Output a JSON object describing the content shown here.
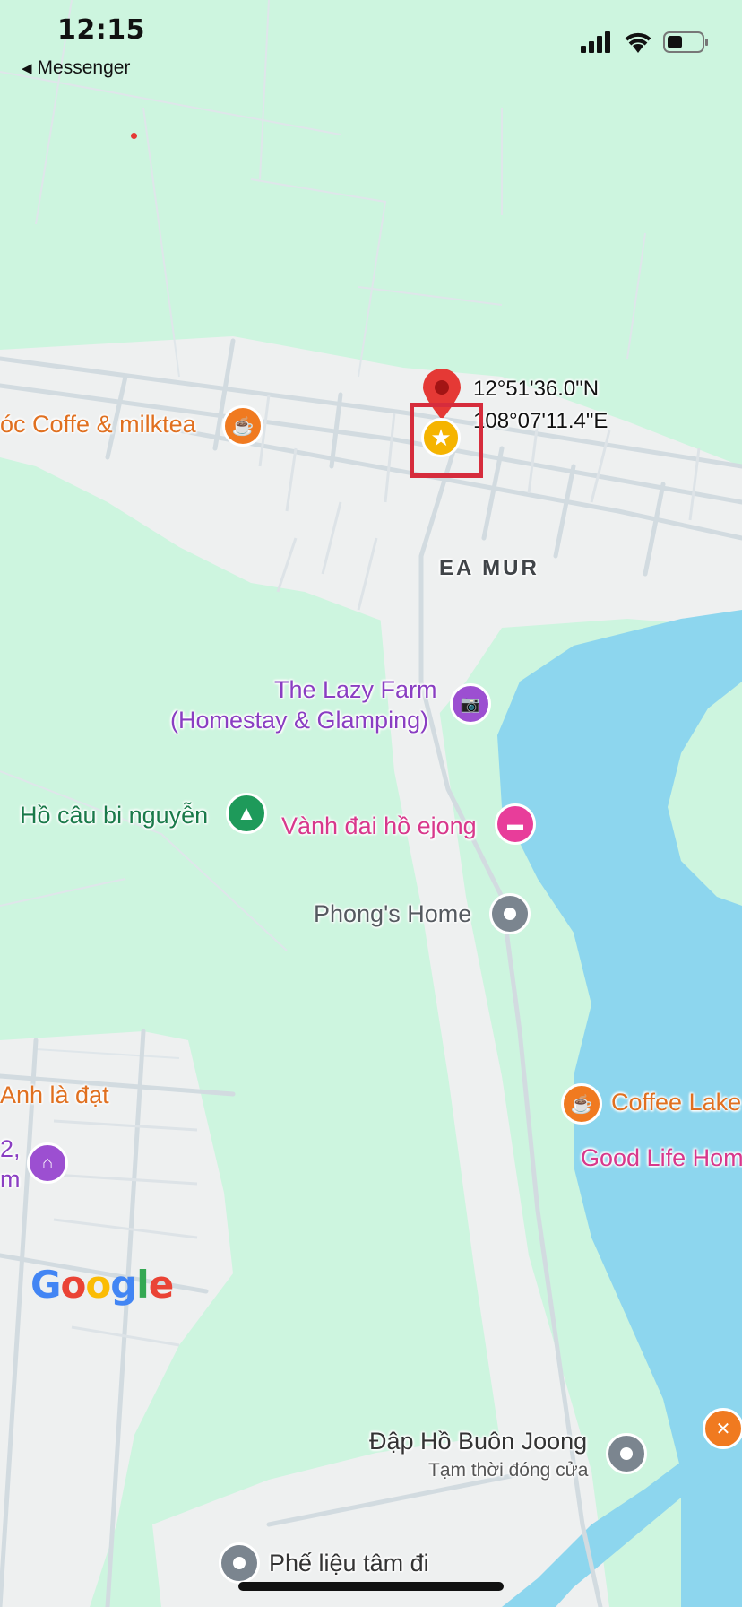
{
  "status_bar": {
    "time": "12:15",
    "back_app": "Messenger",
    "back_glyph": "◀",
    "icons": [
      "cellular-signal-icon",
      "wifi-icon",
      "battery-icon"
    ]
  },
  "map": {
    "pin": {
      "lat": "12°51'36.0\"N",
      "lng": "108°07'11.4\"E"
    },
    "area_label": "EA MUR",
    "places": [
      {
        "name": "óc Coffe & milktea",
        "icon": "coffee-icon",
        "color": "#f07a20"
      },
      {
        "name": "The Lazy Farm",
        "name_line2": "(Homestay & Glamping)",
        "icon": "camera-icon",
        "color": "#9c4fd1"
      },
      {
        "name": "Hồ câu bi nguyễn",
        "icon": "tree-icon",
        "color": "#1e9a5a"
      },
      {
        "name": "Vành đai hồ ejong",
        "icon": "bed-icon",
        "color": "#e83d9a"
      },
      {
        "name": "Phong's Home",
        "icon": "place-icon",
        "color": "#7b858f"
      },
      {
        "name": "Anh là đạt",
        "icon": "",
        "color": "#e07020"
      },
      {
        "name_line1": "2,",
        "name_line2": "m",
        "icon": "landmark-icon",
        "color": "#9c4fd1"
      },
      {
        "name": "Coffee Lake",
        "icon": "coffee-icon",
        "color": "#f07a20"
      },
      {
        "name": "Good Life Hom",
        "icon": "",
        "color": "#d8388c"
      },
      {
        "name": "Đập Hồ Buôn Joong",
        "status": "Tạm thời đóng cửa",
        "icon": "place-icon",
        "color": "#7b858f"
      },
      {
        "name": "",
        "icon": "restaurant-icon",
        "color": "#f07a20"
      },
      {
        "name": "Phế liệu tâm đi",
        "icon": "place-icon",
        "color": "#7b858f"
      }
    ],
    "logo": "Google",
    "colors": {
      "land": "#cdf5df",
      "road": "#eef0f0",
      "water": "#8dd6ee",
      "highlight": "#d62c3c",
      "pin": "#e53935"
    }
  }
}
